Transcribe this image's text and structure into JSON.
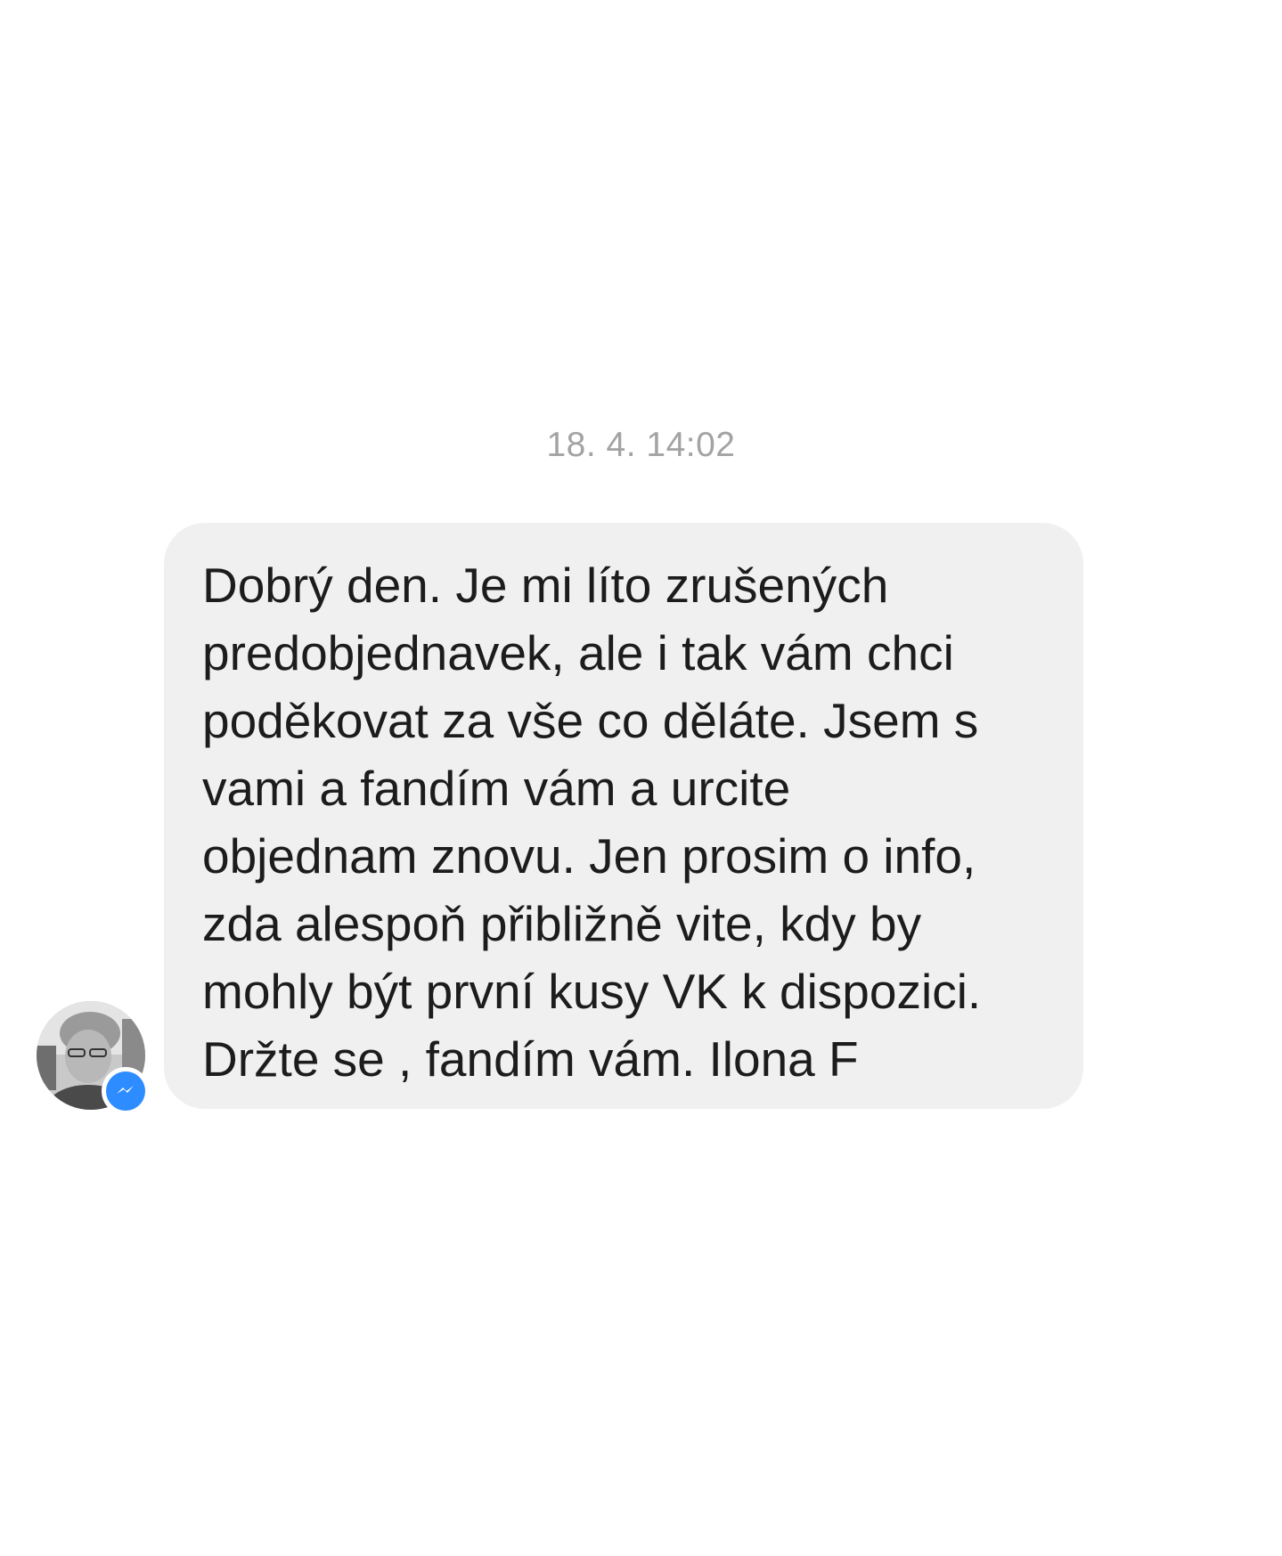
{
  "conversation": {
    "timestamp": "18. 4. 14:02",
    "message": {
      "lines": [
        "Dobrý den. Je mi líto zrušených",
        "predobjednavek, ale i tak vám chci",
        "poděkovat za vše co děláte. Jsem s",
        "vami a fandím vám a urcite",
        "objednam znovu. Jen prosim o info,",
        "zda alespoň přibližně vite, kdy by",
        "mohly být první kusy VK k dispozici.",
        "Držte se , fandím vám. Ilona F"
      ],
      "bubble_color": "#f0f0f0",
      "text_color": "#1c1c1c"
    },
    "sender": {
      "avatar_icon": "avatar",
      "badge_icon": "messenger-icon",
      "badge_color": "#2d8cff"
    }
  }
}
